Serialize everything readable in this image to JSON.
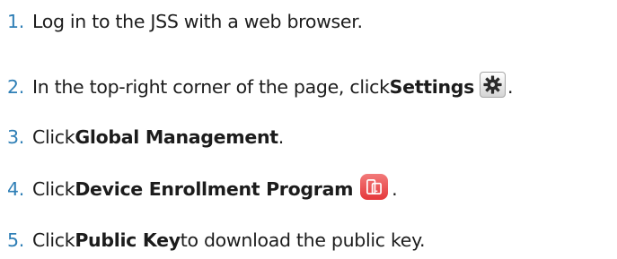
{
  "steps": [
    {
      "number": "1.",
      "parts": {
        "text": "Log in to the JSS with a web browser."
      }
    },
    {
      "number": "2.",
      "parts": {
        "prefix": "In the top-right corner of the page, click ",
        "bold": "Settings",
        "icon": "gear-icon",
        "suffix": "."
      }
    },
    {
      "number": "3.",
      "parts": {
        "prefix": "Click ",
        "bold": "Global Management",
        "suffix": "."
      }
    },
    {
      "number": "4.",
      "parts": {
        "prefix": "Click ",
        "bold": "Device Enrollment Program",
        "icon": "device-enrollment-icon",
        "suffix": "."
      }
    },
    {
      "number": "5.",
      "parts": {
        "prefix": "Click ",
        "bold": "Public Key",
        "suffix": " to download the public key."
      }
    }
  ],
  "colors": {
    "step_number": "#2f7fb6",
    "text": "#1c1c1c",
    "dep_icon": "#e5383b"
  }
}
